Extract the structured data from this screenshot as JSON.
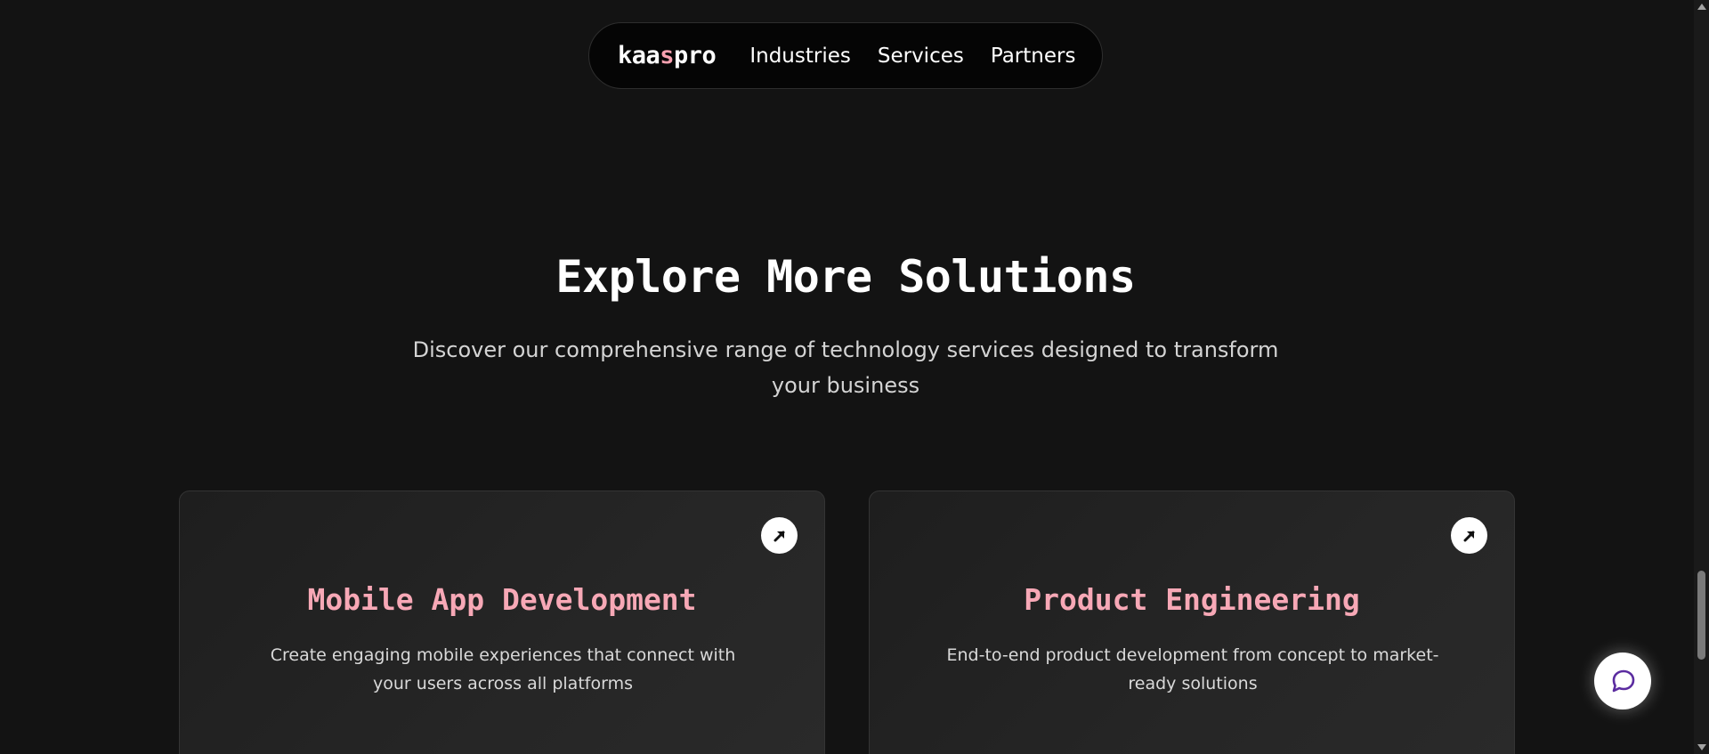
{
  "header": {
    "logo": {
      "part1": "kaa",
      "accent": "s",
      "part2": "pro"
    },
    "nav": [
      {
        "label": "Industries"
      },
      {
        "label": "Services"
      },
      {
        "label": "Partners"
      }
    ]
  },
  "section": {
    "title": "Explore More Solutions",
    "subtitle": "Discover our comprehensive range of technology services designed to transform your business"
  },
  "cards": [
    {
      "title": "Mobile App Development",
      "description": "Create engaging mobile experiences that connect with your users across all platforms",
      "icon": "arrow-up-right-icon"
    },
    {
      "title": "Product Engineering",
      "description": "End-to-end product development from concept to market-ready solutions",
      "icon": "arrow-up-right-icon"
    }
  ],
  "chat": {
    "icon": "chat-bubble-icon"
  },
  "colors": {
    "background": "#131313",
    "accent": "#f7a8b6",
    "chat_icon": "#5b2ca0"
  }
}
